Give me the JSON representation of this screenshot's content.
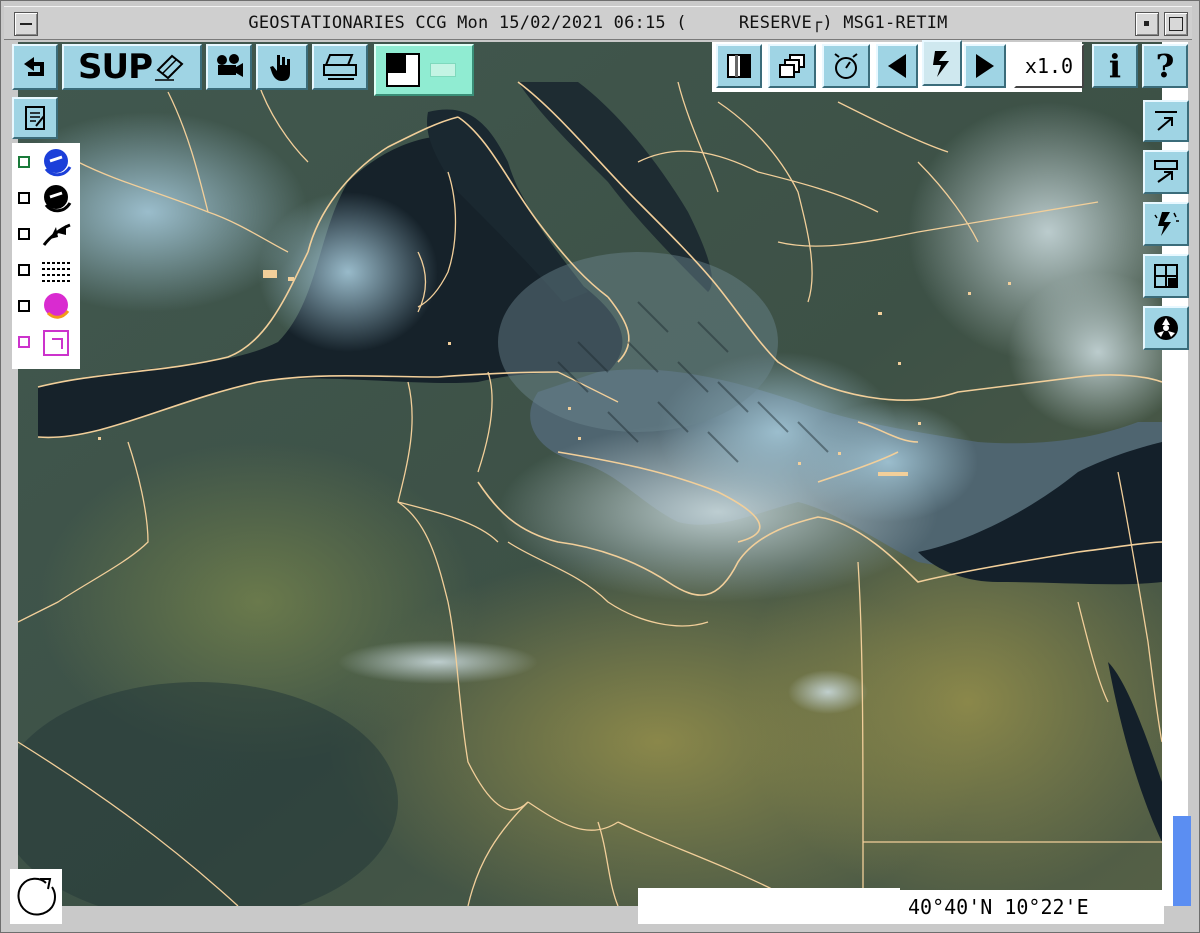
{
  "window": {
    "title": "GEOSTATIONARIES CCG Mon 15/02/2021 06:15 (     RESERVE┌) MSG1-RETIM",
    "controls": [
      "minimize-icon",
      "maximize-icon"
    ]
  },
  "toolbar_left": {
    "back": {
      "icon": "return-arrow-icon"
    },
    "sup": {
      "label": "SUP",
      "icon": "eraser-icon"
    },
    "movie": {
      "icon": "movie-camera-icon"
    },
    "hand": {
      "icon": "hand-pointer-icon"
    },
    "print": {
      "icon": "printer-icon"
    },
    "mode": {
      "items": [
        "black-square-mode-icon",
        "grey-mode-icon"
      ]
    },
    "notes": {
      "icon": "notepad-icon"
    }
  },
  "toolbar_right": {
    "contrast": {
      "icon": "contrast-ramp-icon"
    },
    "layers": {
      "icon": "stacked-windows-icon"
    },
    "timer": {
      "icon": "stopwatch-icon"
    },
    "prev": {
      "icon": "triangle-left-icon"
    },
    "step": {
      "icon": "lightning-step-icon"
    },
    "next": {
      "icon": "triangle-right-icon"
    },
    "zoom": {
      "label": "x1.0"
    },
    "info": {
      "label": "i"
    },
    "help": {
      "label": "?"
    }
  },
  "overlays": [
    {
      "name": "overlay-1",
      "icon": "blue-weather-symbol-icon",
      "border": "#1a7a3a"
    },
    {
      "name": "overlay-2",
      "icon": "black-weather-symbol-icon",
      "border": "#000000"
    },
    {
      "name": "overlay-3",
      "icon": "front-symbol-icon",
      "border": "#000000"
    },
    {
      "name": "overlay-4",
      "icon": "hatched-symbol-icon",
      "border": "#000000"
    },
    {
      "name": "overlay-5",
      "icon": "magenta-weather-symbol-icon",
      "border": "#000000"
    },
    {
      "name": "overlay-6",
      "icon": "magenta-frame-icon",
      "border": "#cc33cc"
    }
  ],
  "side_right": [
    {
      "icon": "export-arrow-icon"
    },
    {
      "icon": "window-arrow-icon"
    },
    {
      "icon": "lightning-sparkle-icon"
    },
    {
      "icon": "grid-cursor-icon"
    },
    {
      "icon": "radiation-icon"
    }
  ],
  "status": {
    "coordinates": "40°40'N 10°22'E"
  },
  "colors": {
    "button_face": "#9fd4e4",
    "mode_face": "#90ecd2",
    "borders": "#ffd39a",
    "scroll": "#5b8ef2"
  }
}
